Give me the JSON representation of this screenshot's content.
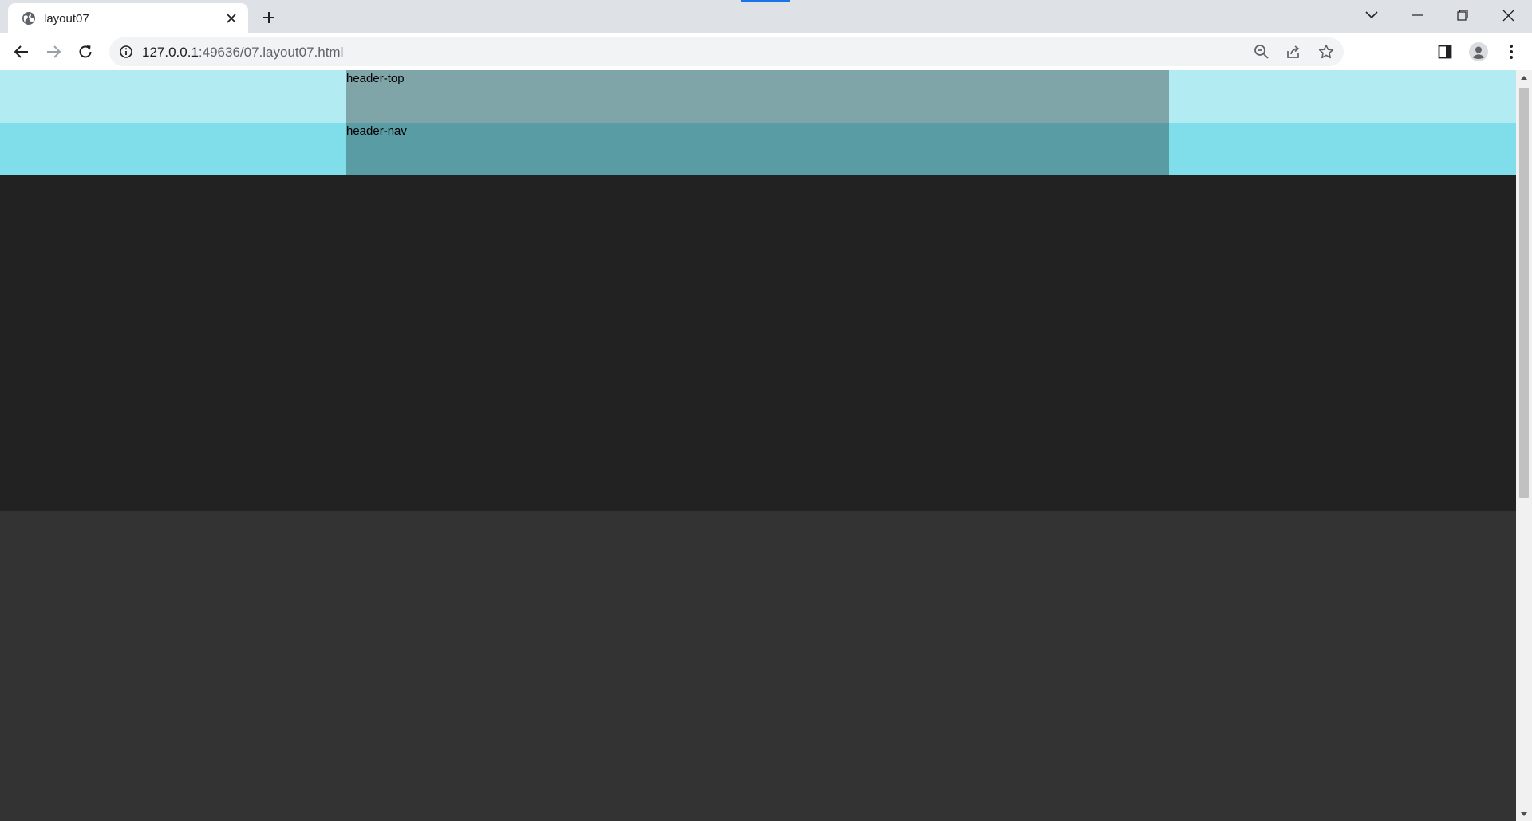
{
  "tab": {
    "title": "layout07",
    "favicon": "globe-icon"
  },
  "omnibox": {
    "host": "127.0.0.1",
    "path": ":49636/07.layout07.html"
  },
  "page": {
    "header_top_label": "header-top",
    "header_nav_label": "header-nav"
  },
  "colors": {
    "tabstrip": "#dee1e6",
    "header_top_band": "#b3ebf2",
    "header_nav_band": "#80deea",
    "header_top": "#7fa5a9",
    "header_nav": "#5a9ca4",
    "slider_band": "#222222",
    "main_band": "#333333"
  }
}
